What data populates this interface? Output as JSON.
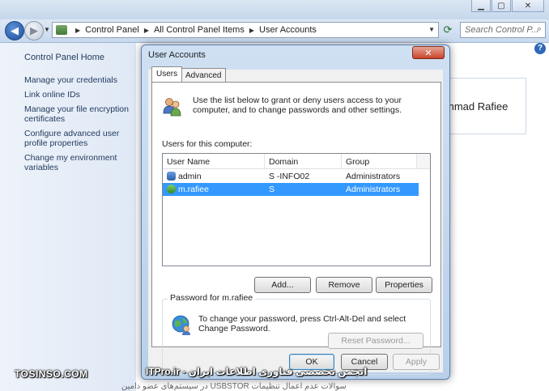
{
  "window": {
    "caption_buttons": [
      "minimize",
      "maximize",
      "close"
    ]
  },
  "navbar": {
    "breadcrumbs": [
      "Control Panel",
      "All Control Panel Items",
      "User Accounts"
    ],
    "search_placeholder": "Search Control P..."
  },
  "leftpane": {
    "home": "Control Panel Home",
    "tasks": [
      "Manage your credentials",
      "Link online IDs",
      "Manage your file encryption certificates",
      "Configure advanced user profile properties",
      "Change my environment variables"
    ]
  },
  "background": {
    "name_fragment": "mmad Rafiee"
  },
  "dialog": {
    "title": "User Accounts",
    "close_glyph": "✕",
    "tabs": [
      "Users",
      "Advanced"
    ],
    "intro_text": "Use the list below to grant or deny users access to your computer, and to change passwords and other settings.",
    "users_label": "Users for this computer:",
    "columns": [
      "User Name",
      "Domain",
      "Group"
    ],
    "users": [
      {
        "name": "admin",
        "domain": "S    -INFO02",
        "group": "Administrators"
      },
      {
        "name": "m.rafiee",
        "domain": "S",
        "group": "Administrators",
        "selected": true
      }
    ],
    "buttons": {
      "add": "Add...",
      "remove": "Remove",
      "properties": "Properties",
      "reset_password": "Reset Password...",
      "ok": "OK",
      "cancel": "Cancel",
      "apply": "Apply"
    },
    "password_group_label": "Password for m.rafiee",
    "password_text": "To change your password, press Ctrl-Alt-Del and select Change Password."
  },
  "watermarks": {
    "left": "TOSINSO.COM",
    "center": "ITPro.ir - انجمن تخصصی فناوری اطلاعات ایران",
    "bottom": "سوالات عدم اعمال تنظیمات USBSTOR در سیستم‌های عضو دامین"
  },
  "colors": {
    "selection": "#3399ff",
    "leftpane_bg": "#dfe8f5",
    "dialog_frame": "#b9d0ea"
  }
}
